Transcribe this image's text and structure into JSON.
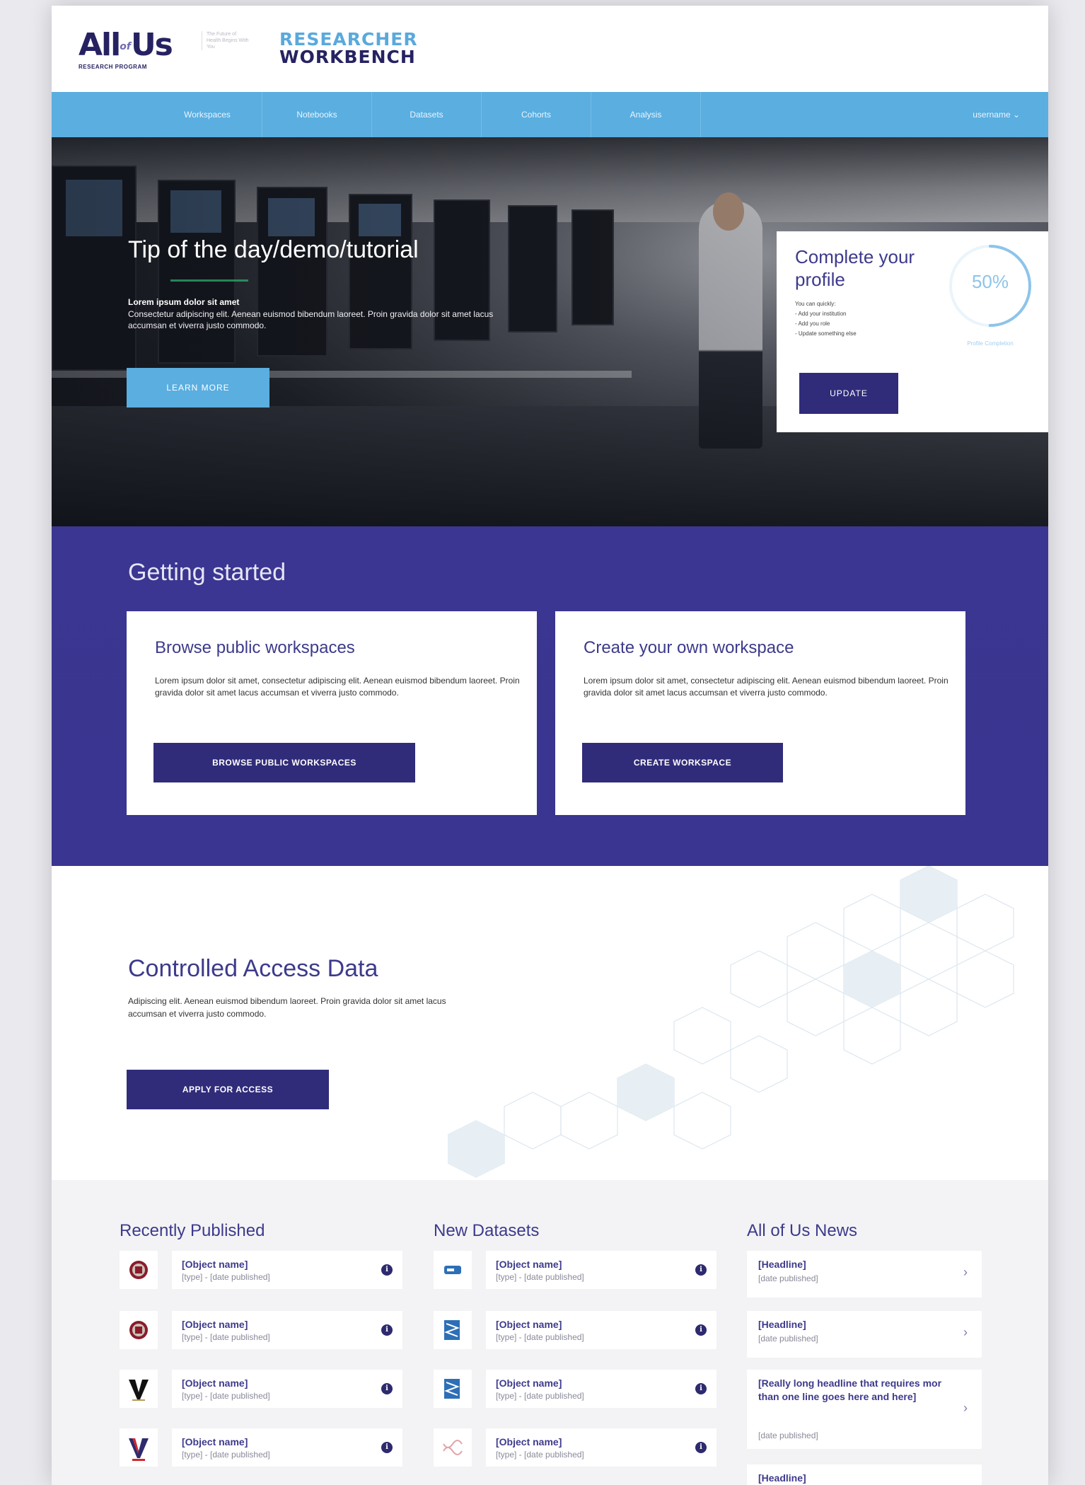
{
  "brand": {
    "main": "All of Us",
    "sub": "RESEARCH PROGRAM",
    "tagline": "The Future of Health Begins With You",
    "product_line1": "RESEARCHER",
    "product_line2": "WORKBENCH"
  },
  "nav": {
    "items": [
      "Workspaces",
      "Notebooks",
      "Datasets",
      "Cohorts",
      "Analysis"
    ],
    "user": "username ⌄"
  },
  "hero": {
    "title": "Tip of the day/demo/tutorial",
    "lead": "Lorem ipsum dolor sit amet",
    "body": "Consectetur adipiscing elit. Aenean euismod bibendum laoreet. Proin gravida dolor sit amet lacus accumsan et viverra justo commodo.",
    "button": "LEARN MORE"
  },
  "profile": {
    "title": "Complete your profile",
    "hint": "You can quickly:",
    "tasks": [
      "- Add your institution",
      "- Add you role",
      "- Update something else"
    ],
    "percent_label": "50%",
    "percent": 0.5,
    "caption": "Profile Completion",
    "button": "UPDATE"
  },
  "getting_started": {
    "title": "Getting started",
    "cards": [
      {
        "title": "Browse public workspaces",
        "body": "Lorem ipsum dolor sit amet, consectetur adipiscing elit. Aenean euismod bibendum laoreet. Proin gravida dolor sit amet lacus accumsan et viverra justo commodo.",
        "button": "BROWSE PUBLIC WORKSPACES"
      },
      {
        "title": "Create your own workspace",
        "body": "Lorem ipsum dolor sit amet, consectetur adipiscing elit. Aenean euismod bibendum laoreet. Proin gravida dolor sit amet lacus accumsan et viverra justo commodo.",
        "button": "CREATE WORKSPACE"
      }
    ]
  },
  "controlled_access": {
    "title": "Controlled Access Data",
    "body": "Adipiscing elit. Aenean euismod bibendum laoreet. Proin gravida dolor sit amet lacus accumsan et viverra justo commodo.",
    "button": "APPLY FOR ACCESS"
  },
  "recently_published": {
    "title": "Recently Published",
    "items": [
      {
        "name": "[Object name]",
        "meta": "[type] - [date published]",
        "icon": "harvard-shield-icon"
      },
      {
        "name": "[Object name]",
        "meta": "[type] - [date published]",
        "icon": "harvard-shield-icon"
      },
      {
        "name": "[Object name]",
        "meta": "[type] - [date published]",
        "icon": "vanderbilt-v-icon"
      },
      {
        "name": "[Object name]",
        "meta": "[type] - [date published]",
        "icon": "red-v-icon"
      }
    ]
  },
  "new_datasets": {
    "title": "New Datasets",
    "items": [
      {
        "name": "[Object name]",
        "meta": "[type] - [date published]",
        "icon": "database-tag-icon"
      },
      {
        "name": "[Object name]",
        "meta": "[type] - [date published]",
        "icon": "dataset-tree-icon"
      },
      {
        "name": "[Object name]",
        "meta": "[type] - [date published]",
        "icon": "dataset-tree-icon"
      },
      {
        "name": "[Object name]",
        "meta": "[type] - [date published]",
        "icon": "dna-icon"
      }
    ]
  },
  "news": {
    "title": "All of Us News",
    "items": [
      {
        "headline": "[Headline]",
        "date": "[date published]"
      },
      {
        "headline": "[Headline]",
        "date": "[date published]"
      },
      {
        "headline": "[Really long headline that requires mor than one line goes here and here]",
        "date": "[date published]"
      },
      {
        "headline": "[Headline]",
        "date": ""
      }
    ]
  },
  "colors": {
    "brand_navy": "#262262",
    "brand_purple": "#3b3691",
    "button_navy": "#302c7a",
    "nav_blue": "#5aaee0",
    "heading_purple": "#3d3a8c"
  }
}
